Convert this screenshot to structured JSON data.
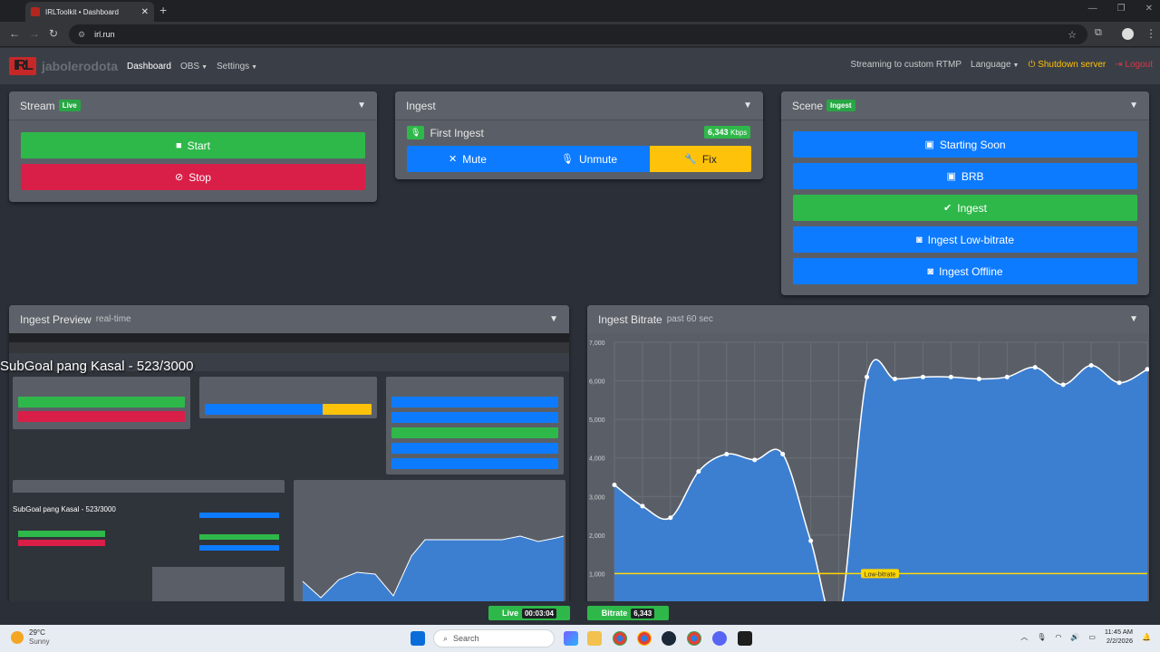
{
  "browser": {
    "tab_title": "IRLToolkit • Dashboard",
    "url": "irl.run"
  },
  "nav": {
    "logo": "IRL",
    "username": "jabolerodota",
    "links": [
      "Dashboard",
      "OBS",
      "Settings"
    ],
    "status_text": "Streaming to custom RTMP",
    "language": "Language",
    "shutdown": "Shutdown server",
    "logout": "Logout"
  },
  "stream_card": {
    "title": "Stream",
    "badge": "Live",
    "start": "Start",
    "stop": "Stop"
  },
  "ingest_card": {
    "title": "Ingest",
    "ingest_name": "First Ingest",
    "kbps_value": "6,343",
    "kbps_unit": "Kbps",
    "mute": "Mute",
    "unmute": "Unmute",
    "fix": "Fix"
  },
  "scene_card": {
    "title": "Scene",
    "badge": "Ingest",
    "scenes": [
      "Starting Soon",
      "BRB",
      "Ingest",
      "Ingest Low-bitrate",
      "Ingest Offline"
    ],
    "active_scene": "Ingest"
  },
  "preview_card": {
    "title": "Ingest Preview",
    "subtitle": "real-time",
    "overlay": "SubGoal pang Kasal - 523/3000",
    "inner_overlay": "SubGoal pang Kasal - 523/3000"
  },
  "bitrate_card": {
    "title": "Ingest Bitrate",
    "subtitle": "past 60 sec"
  },
  "chart_data": {
    "type": "area",
    "yticks": [
      "1,000",
      "2,000",
      "3,000",
      "4,000",
      "5,000",
      "6,000",
      "7,000"
    ],
    "ylim": [
      0,
      7000
    ],
    "threshold_label": "Low-bitrate",
    "threshold_value": 1000,
    "series": [
      {
        "values": [
          3300,
          2750,
          2450,
          3650,
          4100,
          3950,
          4100,
          1850,
          -200,
          6100,
          6050,
          6100,
          6100,
          6050,
          6100,
          6350,
          5900,
          6400,
          5950,
          6300
        ]
      }
    ],
    "grid": true,
    "colors": {
      "fill": "#3c7fd1",
      "line": "#ffffff",
      "threshold": "#ffd600"
    }
  },
  "statusbar": {
    "live_label": "Live",
    "live_time": "00:03:04",
    "bitrate_label": "Bitrate",
    "bitrate_value": "6,343"
  },
  "taskbar": {
    "temp": "29°C",
    "weather": "Sunny",
    "search": "Search",
    "time": "11:45 AM",
    "date": "2/2/2026"
  }
}
